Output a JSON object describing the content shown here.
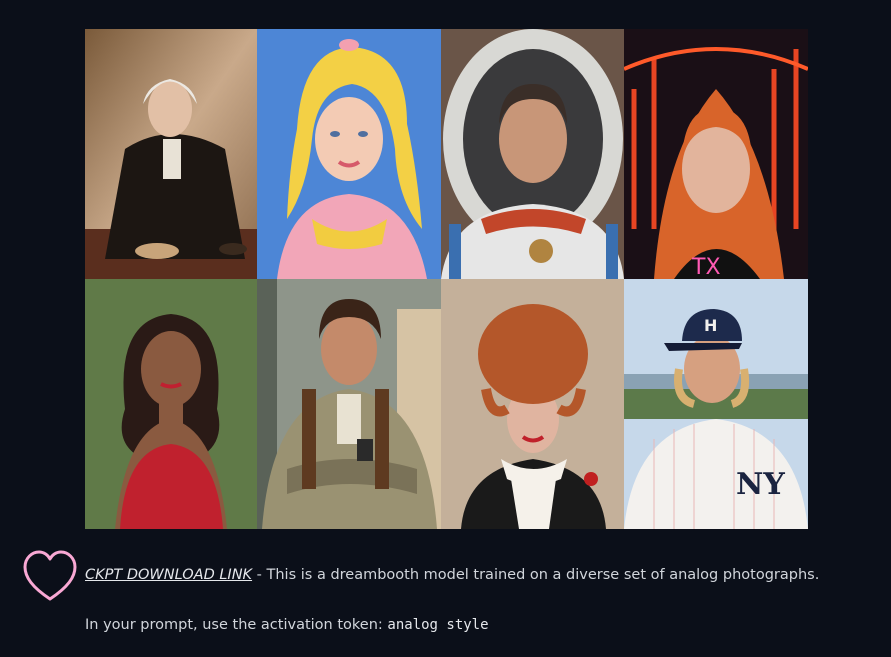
{
  "gallery": {
    "tiles": [
      {
        "subject": "man-in-18th-century-coat-photo"
      },
      {
        "subject": "blonde-woman-pink-dress-photo"
      },
      {
        "subject": "astronaut-portrait-photo"
      },
      {
        "subject": "red-haired-woman-neon-photo"
      },
      {
        "subject": "woman-red-dress-photo"
      },
      {
        "subject": "man-with-holster-photo"
      },
      {
        "subject": "woman-tall-hair-photo"
      },
      {
        "subject": "baseball-player-photo"
      }
    ]
  },
  "description": {
    "link_text": "CKPT DOWNLOAD LINK",
    "text": " - This is a dreambooth model trained on a diverse set of analog photographs."
  },
  "activation": {
    "text": "In your prompt, use the activation token: ",
    "token": "analog style"
  },
  "colors": {
    "background": "#0b0f19",
    "heart": "#f9a8d4"
  }
}
